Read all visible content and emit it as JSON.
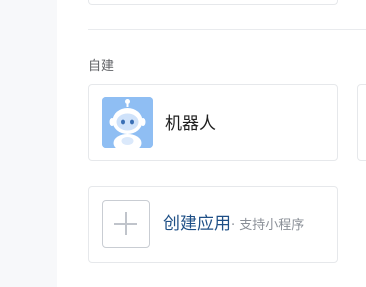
{
  "section": {
    "title": "自建"
  },
  "bot_card": {
    "name": "机器人",
    "icon": "robot-avatar-icon"
  },
  "create_card": {
    "label": "创建应用",
    "sub_label": "· 支持小程序",
    "icon": "plus-icon"
  },
  "colors": {
    "sidebar_bg": "#f7f8fa",
    "card_border": "#e6e8eb",
    "avatar_bg": "#8fbef3",
    "link_blue": "#1e4f86",
    "muted_text": "#8a8f97"
  }
}
